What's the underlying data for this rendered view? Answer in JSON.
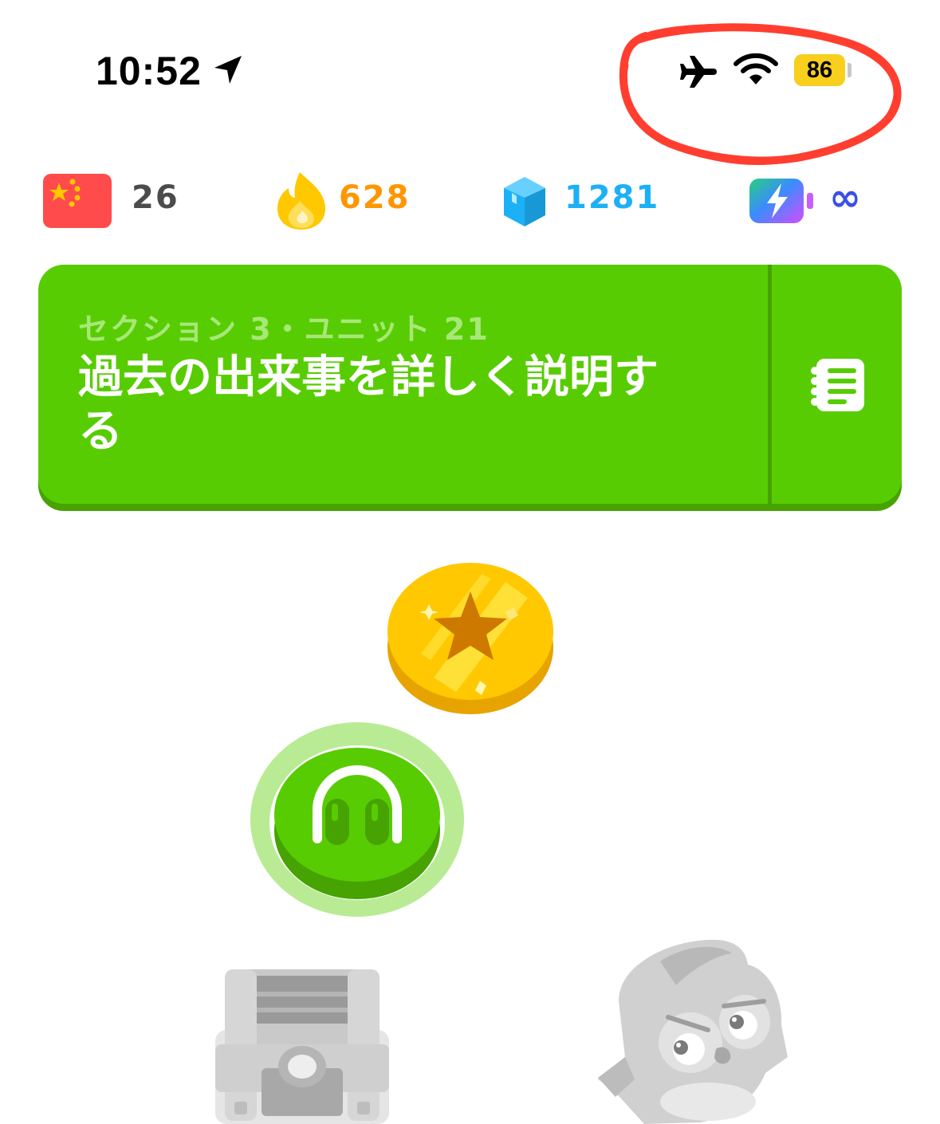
{
  "status_bar": {
    "time": "10:52",
    "battery": "86",
    "icons": [
      "location-arrow-icon",
      "airplane-icon",
      "wifi-icon",
      "battery-icon"
    ]
  },
  "stats": {
    "course_count": "26",
    "streak": "628",
    "gems": "1281",
    "energy": "∞",
    "icons": [
      "china-flag-icon",
      "streak-flame-icon",
      "gem-icon",
      "energy-battery-icon"
    ]
  },
  "unit": {
    "section_label": "セクション 3・ユニット 21",
    "title": "過去の出来事を詳しく説明する",
    "guidebook_icon": "guidebook-icon"
  },
  "path": {
    "nodes": [
      "star-coin-icon",
      "headphones-icon",
      "treasure-chest-icon",
      "mascot-icon"
    ]
  },
  "colors": {
    "brand_green": "#58cc02",
    "green_shadow": "#46a302",
    "streak_orange": "#ff9600",
    "gem_blue": "#1cb0f6",
    "energy_indigo": "#3b50e8",
    "battery_yellow": "#f7cf1c",
    "annotation_red": "#ff2a1a"
  }
}
